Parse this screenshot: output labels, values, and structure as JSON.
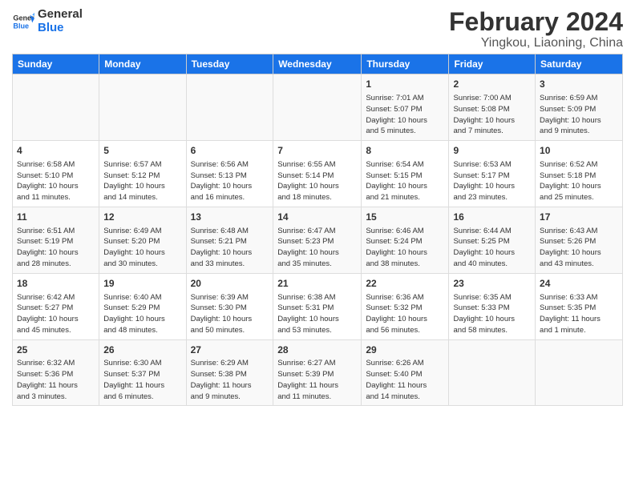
{
  "logo": {
    "text_general": "General",
    "text_blue": "Blue"
  },
  "header": {
    "main_title": "February 2024",
    "subtitle": "Yingkou, Liaoning, China"
  },
  "weekdays": [
    "Sunday",
    "Monday",
    "Tuesday",
    "Wednesday",
    "Thursday",
    "Friday",
    "Saturday"
  ],
  "weeks": [
    [
      {
        "day": "",
        "info": ""
      },
      {
        "day": "",
        "info": ""
      },
      {
        "day": "",
        "info": ""
      },
      {
        "day": "",
        "info": ""
      },
      {
        "day": "1",
        "info": "Sunrise: 7:01 AM\nSunset: 5:07 PM\nDaylight: 10 hours\nand 5 minutes."
      },
      {
        "day": "2",
        "info": "Sunrise: 7:00 AM\nSunset: 5:08 PM\nDaylight: 10 hours\nand 7 minutes."
      },
      {
        "day": "3",
        "info": "Sunrise: 6:59 AM\nSunset: 5:09 PM\nDaylight: 10 hours\nand 9 minutes."
      }
    ],
    [
      {
        "day": "4",
        "info": "Sunrise: 6:58 AM\nSunset: 5:10 PM\nDaylight: 10 hours\nand 11 minutes."
      },
      {
        "day": "5",
        "info": "Sunrise: 6:57 AM\nSunset: 5:12 PM\nDaylight: 10 hours\nand 14 minutes."
      },
      {
        "day": "6",
        "info": "Sunrise: 6:56 AM\nSunset: 5:13 PM\nDaylight: 10 hours\nand 16 minutes."
      },
      {
        "day": "7",
        "info": "Sunrise: 6:55 AM\nSunset: 5:14 PM\nDaylight: 10 hours\nand 18 minutes."
      },
      {
        "day": "8",
        "info": "Sunrise: 6:54 AM\nSunset: 5:15 PM\nDaylight: 10 hours\nand 21 minutes."
      },
      {
        "day": "9",
        "info": "Sunrise: 6:53 AM\nSunset: 5:17 PM\nDaylight: 10 hours\nand 23 minutes."
      },
      {
        "day": "10",
        "info": "Sunrise: 6:52 AM\nSunset: 5:18 PM\nDaylight: 10 hours\nand 25 minutes."
      }
    ],
    [
      {
        "day": "11",
        "info": "Sunrise: 6:51 AM\nSunset: 5:19 PM\nDaylight: 10 hours\nand 28 minutes."
      },
      {
        "day": "12",
        "info": "Sunrise: 6:49 AM\nSunset: 5:20 PM\nDaylight: 10 hours\nand 30 minutes."
      },
      {
        "day": "13",
        "info": "Sunrise: 6:48 AM\nSunset: 5:21 PM\nDaylight: 10 hours\nand 33 minutes."
      },
      {
        "day": "14",
        "info": "Sunrise: 6:47 AM\nSunset: 5:23 PM\nDaylight: 10 hours\nand 35 minutes."
      },
      {
        "day": "15",
        "info": "Sunrise: 6:46 AM\nSunset: 5:24 PM\nDaylight: 10 hours\nand 38 minutes."
      },
      {
        "day": "16",
        "info": "Sunrise: 6:44 AM\nSunset: 5:25 PM\nDaylight: 10 hours\nand 40 minutes."
      },
      {
        "day": "17",
        "info": "Sunrise: 6:43 AM\nSunset: 5:26 PM\nDaylight: 10 hours\nand 43 minutes."
      }
    ],
    [
      {
        "day": "18",
        "info": "Sunrise: 6:42 AM\nSunset: 5:27 PM\nDaylight: 10 hours\nand 45 minutes."
      },
      {
        "day": "19",
        "info": "Sunrise: 6:40 AM\nSunset: 5:29 PM\nDaylight: 10 hours\nand 48 minutes."
      },
      {
        "day": "20",
        "info": "Sunrise: 6:39 AM\nSunset: 5:30 PM\nDaylight: 10 hours\nand 50 minutes."
      },
      {
        "day": "21",
        "info": "Sunrise: 6:38 AM\nSunset: 5:31 PM\nDaylight: 10 hours\nand 53 minutes."
      },
      {
        "day": "22",
        "info": "Sunrise: 6:36 AM\nSunset: 5:32 PM\nDaylight: 10 hours\nand 56 minutes."
      },
      {
        "day": "23",
        "info": "Sunrise: 6:35 AM\nSunset: 5:33 PM\nDaylight: 10 hours\nand 58 minutes."
      },
      {
        "day": "24",
        "info": "Sunrise: 6:33 AM\nSunset: 5:35 PM\nDaylight: 11 hours\nand 1 minute."
      }
    ],
    [
      {
        "day": "25",
        "info": "Sunrise: 6:32 AM\nSunset: 5:36 PM\nDaylight: 11 hours\nand 3 minutes."
      },
      {
        "day": "26",
        "info": "Sunrise: 6:30 AM\nSunset: 5:37 PM\nDaylight: 11 hours\nand 6 minutes."
      },
      {
        "day": "27",
        "info": "Sunrise: 6:29 AM\nSunset: 5:38 PM\nDaylight: 11 hours\nand 9 minutes."
      },
      {
        "day": "28",
        "info": "Sunrise: 6:27 AM\nSunset: 5:39 PM\nDaylight: 11 hours\nand 11 minutes."
      },
      {
        "day": "29",
        "info": "Sunrise: 6:26 AM\nSunset: 5:40 PM\nDaylight: 11 hours\nand 14 minutes."
      },
      {
        "day": "",
        "info": ""
      },
      {
        "day": "",
        "info": ""
      }
    ]
  ]
}
